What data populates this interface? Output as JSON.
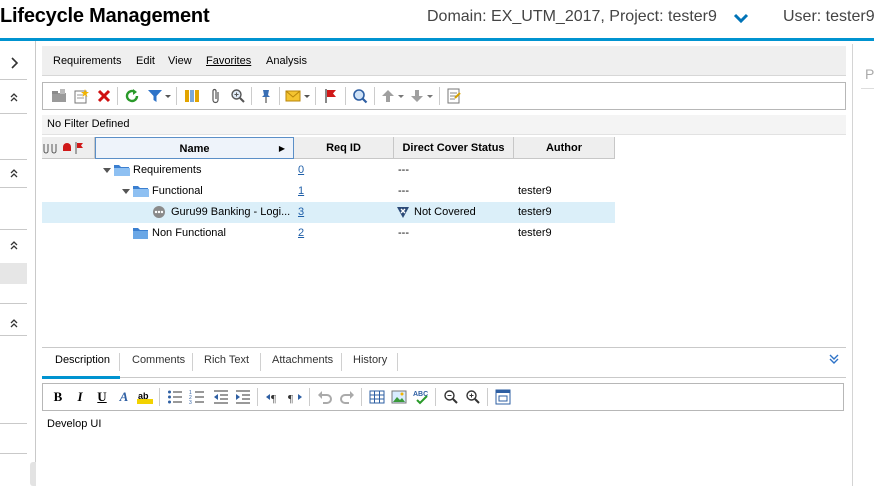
{
  "header": {
    "title": "Lifecycle Management",
    "domain_project": "Domain: EX_UTM_2017, Project: tester9",
    "user": "User: tester9",
    "accent_color": "#0093d0"
  },
  "menubar": {
    "items": [
      "Requirements",
      "Edit",
      "View",
      "Favorites",
      "Analysis"
    ]
  },
  "toolbar": {
    "icons": [
      "new-folder-icon",
      "new-requirement-icon",
      "delete-icon",
      "refresh-icon",
      "filter-icon",
      "columns-icon",
      "attachment-icon",
      "zoom-icon",
      "pin-icon",
      "mail-icon",
      "flag-icon",
      "find-icon",
      "move-up-icon",
      "move-down-icon",
      "report-icon"
    ]
  },
  "filter": {
    "text": "No Filter Defined"
  },
  "grid": {
    "columns": [
      "Name",
      "Req ID",
      "Direct Cover Status",
      "Author"
    ],
    "rows": [
      {
        "name": "Requirements",
        "req_id": "0",
        "status": "---",
        "author": ""
      },
      {
        "name": "Functional",
        "req_id": "1",
        "status": "---",
        "author": "tester9"
      },
      {
        "name": "Guru99 Banking - Logi...",
        "req_id": "3",
        "status": "Not Covered",
        "author": "tester9"
      },
      {
        "name": "Non Functional",
        "req_id": "2",
        "status": "---",
        "author": "tester9"
      }
    ]
  },
  "details": {
    "tabs": [
      "Description",
      "Comments",
      "Rich Text",
      "Attachments",
      "History"
    ],
    "active_tab": "Description",
    "description": "Develop UI"
  },
  "right_panel": {
    "letter": "P"
  }
}
